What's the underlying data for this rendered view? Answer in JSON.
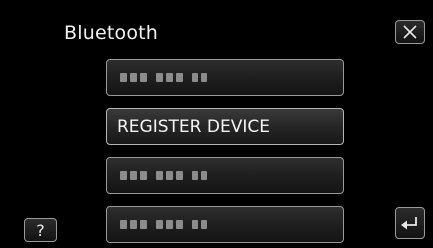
{
  "header": {
    "title": "Bluetooth"
  },
  "menu": {
    "items": [
      {
        "type": "placeholder",
        "text": ""
      },
      {
        "type": "label",
        "text": "REGISTER DEVICE"
      },
      {
        "type": "placeholder",
        "text": ""
      },
      {
        "type": "placeholder",
        "text": ""
      }
    ]
  },
  "controls": {
    "close_icon": "close-icon",
    "back_icon": "return-arrow-icon",
    "help_label": "?"
  },
  "colors": {
    "background": "#000000",
    "button_border": "#9a9a9a",
    "text": "#f5f5f5"
  }
}
